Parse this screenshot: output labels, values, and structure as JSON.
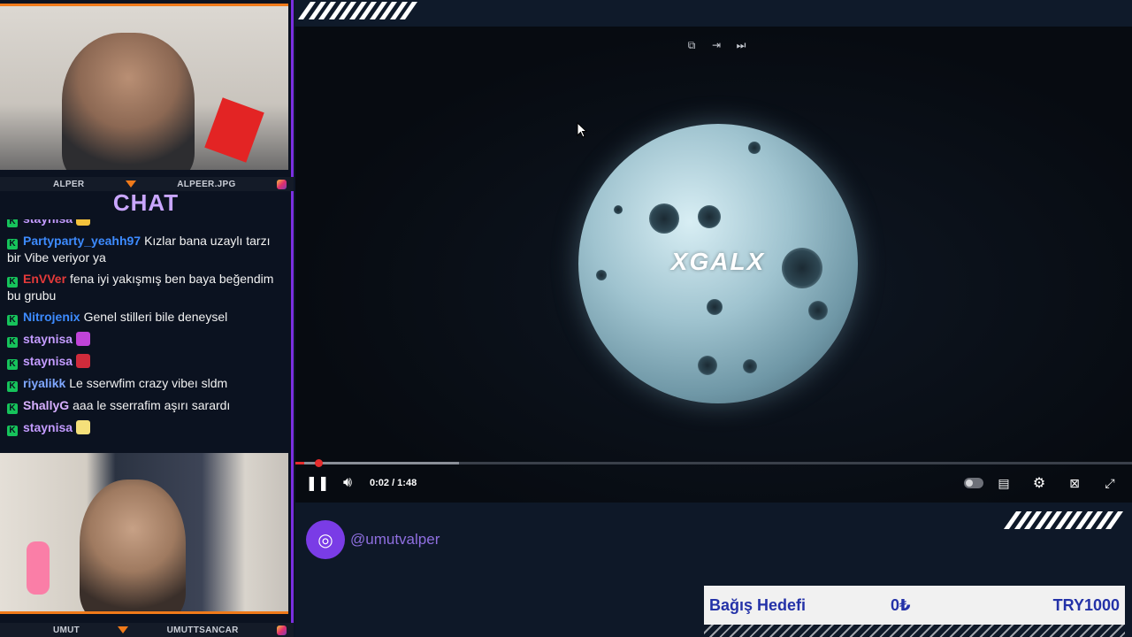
{
  "top_cam": {
    "left_label": "ALPER",
    "right_label": "ALPEER.JPG"
  },
  "bottom_cam": {
    "left_label": "UMUT",
    "right_label": "UMUTTSANCAR"
  },
  "chat": {
    "title": "CHAT",
    "messages": [
      {
        "user": "staynisa",
        "color": "#c39bff",
        "text": "",
        "emote": "#f5c23c"
      },
      {
        "user": "Partyparty_yeahh97",
        "color": "#3d8bff",
        "text": "Kızlar bana uzaylı tarzı bir Vibe veriyor ya"
      },
      {
        "user": "EnVVer",
        "color": "#e53a3a",
        "text": "fena iyi yakışmış ben baya beğendim bu grubu"
      },
      {
        "user": "Nitrojenix",
        "color": "#3d8bff",
        "text": "Genel stilleri bile deneysel"
      },
      {
        "user": "staynisa",
        "color": "#c39bff",
        "text": "",
        "emote": "#c044d8"
      },
      {
        "user": "staynisa",
        "color": "#c39bff",
        "text": "",
        "emote": "#d02b3b"
      },
      {
        "user": "riyalikk",
        "color": "#7fa7ff",
        "text": "Le sserwfim crazy vibeı sldm"
      },
      {
        "user": "ShallyG",
        "color": "#d7b0ff",
        "text": "aaa le sserrafim aşırı sarardı"
      },
      {
        "user": "staynisa",
        "color": "#c39bff",
        "text": "",
        "emote": "#f5e07a"
      }
    ]
  },
  "video": {
    "title_art": "XGALX",
    "time": "0:02 / 1:48",
    "played_fraction": 0.011,
    "buffered_fraction": 0.196,
    "top_icons": [
      "popout-icon",
      "cast-icon",
      "next-icon"
    ]
  },
  "social": {
    "handle": "@umutvalper"
  },
  "donation_goal": {
    "label": "Bağış Hedefi",
    "current": "0₺",
    "target": "TRY1000"
  }
}
